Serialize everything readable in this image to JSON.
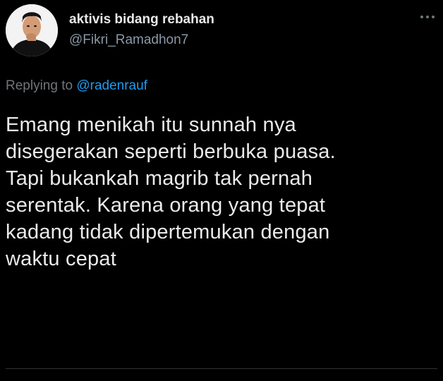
{
  "tweet": {
    "display_name": "aktivis bidang rebahan",
    "handle": "@Fikri_Ramadhon7",
    "replying_prefix": "Replying to",
    "replying_to": "@radenrauf",
    "lines": [
      "Emang menikah itu sunnah nya",
      "disegerakan seperti berbuka puasa.",
      "Tapi bukankah magrib tak pernah",
      "serentak. Karena orang yang tepat",
      "kadang tidak dipertemukan dengan",
      "waktu cepat"
    ],
    "more_icon": "more-horizontal-icon"
  },
  "colors": {
    "background": "#000000",
    "name": "#e7e9ea",
    "handle": "#8b98a5",
    "mention": "#1d9bf0"
  }
}
